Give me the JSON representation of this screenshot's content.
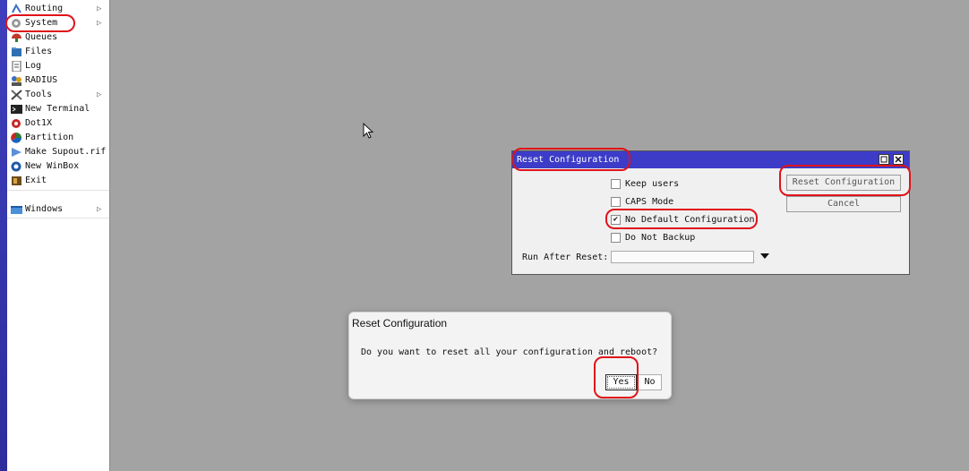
{
  "sidebar": {
    "items": [
      {
        "label": "Routing",
        "icon": "routing-icon",
        "has_submenu": true
      },
      {
        "label": "System",
        "icon": "gear-icon",
        "has_submenu": true
      },
      {
        "label": "Queues",
        "icon": "queues-icon",
        "has_submenu": false
      },
      {
        "label": "Files",
        "icon": "folder-icon",
        "has_submenu": false
      },
      {
        "label": "Log",
        "icon": "log-icon",
        "has_submenu": false
      },
      {
        "label": "RADIUS",
        "icon": "radius-icon",
        "has_submenu": false
      },
      {
        "label": "Tools",
        "icon": "tools-icon",
        "has_submenu": true
      },
      {
        "label": "New Terminal",
        "icon": "terminal-icon",
        "has_submenu": false
      },
      {
        "label": "Dot1X",
        "icon": "dot1x-icon",
        "has_submenu": false
      },
      {
        "label": "Partition",
        "icon": "partition-icon",
        "has_submenu": false
      },
      {
        "label": "Make Supout.rif",
        "icon": "supout-icon",
        "has_submenu": false
      },
      {
        "label": "New WinBox",
        "icon": "winbox-icon",
        "has_submenu": false
      },
      {
        "label": "Exit",
        "icon": "exit-icon",
        "has_submenu": false
      }
    ],
    "windows_label": "Windows"
  },
  "reset_window": {
    "title": "Reset Configuration",
    "checkboxes": [
      {
        "label": "Keep users",
        "checked": false
      },
      {
        "label": "CAPS Mode",
        "checked": false
      },
      {
        "label": "No Default Configuration",
        "checked": true
      },
      {
        "label": "Do Not Backup",
        "checked": false
      }
    ],
    "reset_button": "Reset Configuration",
    "cancel_button": "Cancel",
    "run_after_reset_label": "Run After Reset:",
    "run_after_reset_value": ""
  },
  "confirm_dialog": {
    "title": "Reset Configuration",
    "message": "Do you want to reset all your configuration and reboot?",
    "yes_label": "Yes",
    "no_label": "No"
  },
  "colors": {
    "desktop": "#a3a3a3",
    "title_bar": "#3c3cc8",
    "annotation": "#e0131a"
  }
}
